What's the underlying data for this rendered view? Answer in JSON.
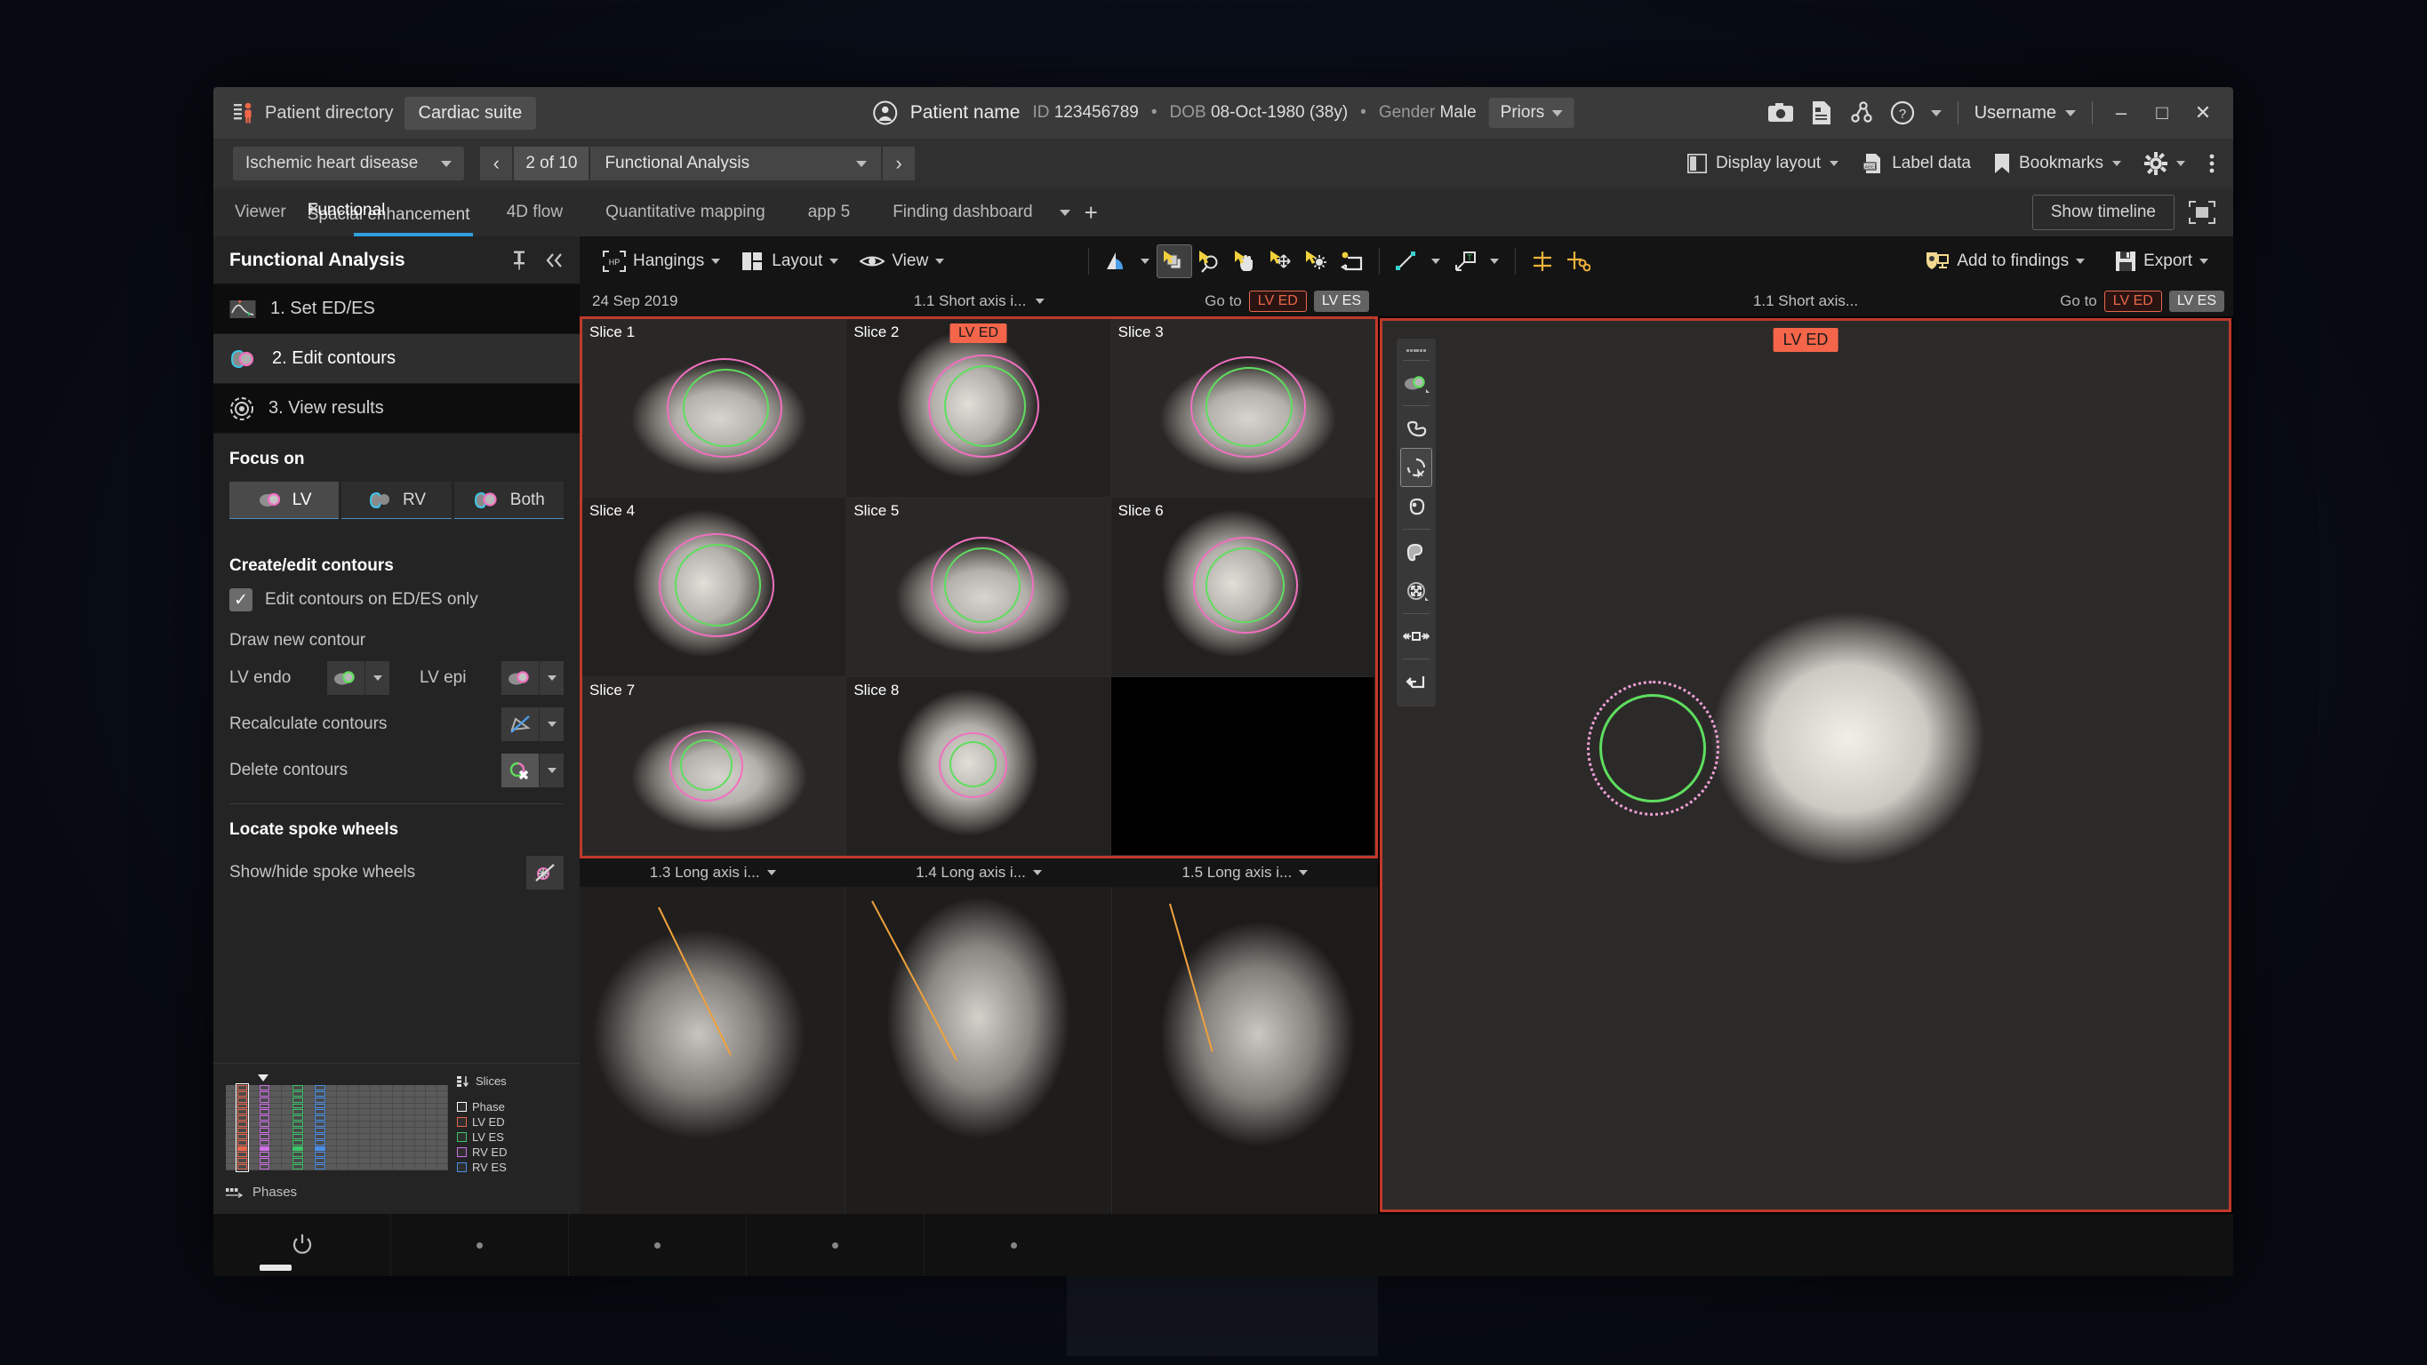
{
  "titlebar": {
    "patient_directory": "Patient directory",
    "cardiac_suite": "Cardiac suite",
    "patient_name": "Patient name",
    "id_label": "ID",
    "id_value": "123456789",
    "dob_label": "DOB",
    "dob_value": "08-Oct-1980 (38y)",
    "gender_label": "Gender",
    "gender_value": "Male",
    "priors": "Priors",
    "username": "Username",
    "minimize": "–",
    "maximize": "□",
    "close": "✕",
    "icons": [
      "camera-icon",
      "report-icon",
      "share-icon",
      "help-icon"
    ]
  },
  "bar2": {
    "protocol": "Ischemic heart disease",
    "prev": "‹",
    "next": "›",
    "count": "2 of 10",
    "step_name": "Functional Analysis",
    "display_layout": "Display layout",
    "label_data": "Label data",
    "bookmarks": "Bookmarks"
  },
  "tabs": {
    "items": [
      {
        "label": "Viewer",
        "active": false
      },
      {
        "label": "4D flow",
        "active": false
      },
      {
        "label": "Quantitative mapping",
        "active": false
      },
      {
        "label": "app 5",
        "active": false
      },
      {
        "label": "Finding dashboard",
        "active": false
      }
    ],
    "active_overlay_front": "Functional",
    "active_overlay_close": "✕",
    "active_overlay_back": "Spacial enhancement",
    "add_tab": "+",
    "show_timeline": "Show timeline"
  },
  "left_panel": {
    "title": "Functional Analysis",
    "steps": [
      {
        "label": "1. Set ED/ES",
        "active": false,
        "icon": "ecg-curve-icon"
      },
      {
        "label": "2. Edit contours",
        "active": true,
        "icon": "lv-rv-contour-icon"
      },
      {
        "label": "3. View results",
        "active": false,
        "icon": "target-results-icon"
      }
    ],
    "focus_on_title": "Focus on",
    "focus_options": [
      {
        "label": "LV",
        "selected": true
      },
      {
        "label": "RV",
        "selected": false
      },
      {
        "label": "Both",
        "selected": false
      }
    ],
    "create_edit_title": "Create/edit contours",
    "edit_only_label": "Edit contours on ED/ES only",
    "edit_only_checked": "✓",
    "draw_new_label": "Draw new contour",
    "lv_endo_label": "LV endo",
    "lv_epi_label": "LV epi",
    "recalculate_label": "Recalculate contours",
    "delete_label": "Delete contours",
    "spoke_title": "Locate spoke wheels",
    "spoke_label": "Show/hide spoke wheels"
  },
  "mini_chart": {
    "slices_label": "Slices",
    "phases_label": "Phases",
    "legend": [
      {
        "label": "Phase",
        "color": "#ffffff"
      },
      {
        "label": "LV ED",
        "color": "#e8674a"
      },
      {
        "label": "LV ES",
        "color": "#3ec46a"
      },
      {
        "label": "RV ED",
        "color": "#d071e8"
      },
      {
        "label": "RV ES",
        "color": "#4a8fe8"
      }
    ],
    "columns": 20,
    "rows": 14,
    "marked_columns": [
      {
        "index": 1,
        "color": "#e8674a",
        "highlight": true,
        "filled_row": 10
      },
      {
        "index": 3,
        "color": "#d071e8",
        "highlight": false,
        "filled_row": 10
      },
      {
        "index": 6,
        "color": "#3ec46a",
        "highlight": false,
        "filled_row": 10
      },
      {
        "index": 8,
        "color": "#4a8fe8",
        "highlight": false,
        "filled_row": 10
      }
    ]
  },
  "viewer_toolbar": {
    "hangings": "Hangings",
    "layout": "Layout",
    "view": "View",
    "tools": [
      {
        "name": "wl-preset-icon",
        "selected": false
      },
      {
        "name": "select-icon",
        "selected": true
      },
      {
        "name": "zoom-icon",
        "selected": false
      },
      {
        "name": "pan-icon",
        "selected": false
      },
      {
        "name": "scroll-icon",
        "selected": false
      },
      {
        "name": "brightness-icon",
        "selected": false
      },
      {
        "name": "reset-icon",
        "selected": false
      },
      {
        "name": "measure-line-icon",
        "selected": false
      },
      {
        "name": "annotate-text-icon",
        "selected": false
      },
      {
        "name": "crosshair-icon",
        "selected": false
      },
      {
        "name": "link-crosshair-icon",
        "selected": false
      }
    ],
    "add_to_findings": "Add to findings",
    "export": "Export"
  },
  "left_viewport": {
    "date": "24 Sep 2019",
    "series": "1.1 Short axis i...",
    "goto_label": "Go to",
    "lv_ed": "LV ED",
    "lv_es": "LV ES",
    "slices": [
      {
        "label": "Slice 1",
        "badge": null
      },
      {
        "label": "Slice 2",
        "badge": "LV ED"
      },
      {
        "label": "Slice 3",
        "badge": null
      },
      {
        "label": "Slice 4",
        "badge": null
      },
      {
        "label": "Slice 5",
        "badge": null
      },
      {
        "label": "Slice 6",
        "badge": null
      },
      {
        "label": "Slice 7",
        "badge": null
      },
      {
        "label": "Slice 8",
        "badge": null
      },
      {
        "label": "",
        "badge": null
      }
    ],
    "long_axis": [
      {
        "label": "1.3 Long axis i..."
      },
      {
        "label": "1.4 Long axis i..."
      },
      {
        "label": "1.5 Long axis i..."
      }
    ]
  },
  "right_viewport": {
    "series": "1.1 Short axis...",
    "goto_label": "Go to",
    "lv_ed": "LV ED",
    "lv_es": "LV ES",
    "badge": "LV ED",
    "tools": [
      {
        "name": "contour-lv-endo-icon",
        "selected": false
      },
      {
        "name": "freehand-contour-icon",
        "selected": false
      },
      {
        "name": "edit-contour-icon",
        "selected": true
      },
      {
        "name": "smooth-contour-icon",
        "selected": false
      },
      {
        "name": "region-fill-icon",
        "selected": false
      },
      {
        "name": "move-all-icon",
        "selected": false
      },
      {
        "name": "width-adjust-icon",
        "selected": false
      },
      {
        "name": "undo-contour-icon",
        "selected": false
      }
    ]
  },
  "statusbar": {
    "power_icon": "power-icon",
    "segments": 5
  },
  "colors": {
    "accent_blue": "#2f9fe0",
    "lv_ed_red": "#e8674a",
    "lv_es_green": "#3ec46a",
    "rv_ed_magenta": "#d071e8",
    "rv_es_blue": "#4a8fe8",
    "epi_pink": "#f06fc0",
    "endo_green": "#5ede5e",
    "viewport_border": "#c0392b"
  }
}
